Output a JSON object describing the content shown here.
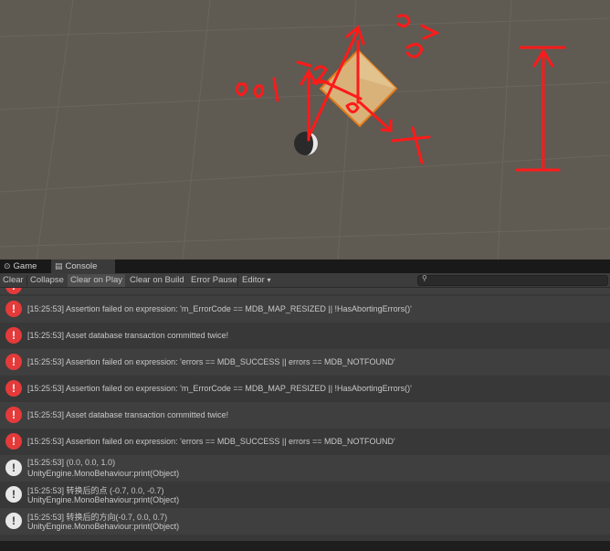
{
  "tabs": {
    "game_label": "Game",
    "console_label": "Console",
    "game_icon": "gamepad-icon",
    "console_icon": "console-icon"
  },
  "toolbar": {
    "clear": "Clear",
    "collapse": "Collapse",
    "clear_on_play": "Clear on Play",
    "clear_on_build": "Clear on Build",
    "error_pause": "Error Pause",
    "editor": "Editor",
    "editor_caret": "▾",
    "search_placeholder": ""
  },
  "logs": [
    {
      "type": "error",
      "line1": "[15:25:53] Assertion failed on expression: 'm_ErrorCode == MDB_MAP_RESIZED || !HasAbortingErrors()'",
      "line2": ""
    },
    {
      "type": "error",
      "line1": "[15:25:53] Asset database transaction committed twice!",
      "line2": ""
    },
    {
      "type": "error",
      "line1": "[15:25:53] Assertion failed on expression: 'errors == MDB_SUCCESS || errors == MDB_NOTFOUND'",
      "line2": ""
    },
    {
      "type": "error",
      "line1": "[15:25:53] Assertion failed on expression: 'm_ErrorCode == MDB_MAP_RESIZED || !HasAbortingErrors()'",
      "line2": ""
    },
    {
      "type": "error",
      "line1": "[15:25:53] Asset database transaction committed twice!",
      "line2": ""
    },
    {
      "type": "error",
      "line1": "[15:25:53] Assertion failed on expression: 'errors == MDB_SUCCESS || errors == MDB_NOTFOUND'",
      "line2": ""
    },
    {
      "type": "info",
      "line1": "[15:25:53] (0.0, 0.0, 1.0)",
      "line2": "UnityEngine.MonoBehaviour:print(Object)"
    },
    {
      "type": "info",
      "line1": "[15:25:53] 转换后的点 (-0.7, 0.0, -0.7)",
      "line2": "UnityEngine.MonoBehaviour:print(Object)"
    },
    {
      "type": "info",
      "line1": "[15:25:53] 转换后的方向(-0.7, 0.0, 0.7)",
      "line2": "UnityEngine.MonoBehaviour:print(Object)"
    }
  ],
  "icons": {
    "error": "!",
    "info": "!"
  },
  "scene": {
    "annotation_color": "#ff1a1a",
    "cube_color": "#d9b27a",
    "handwritten": {
      "o_label": "o",
      "x_label": "x",
      "z_label": "z",
      "v_label": "0.7",
      "w_label": "0.01",
      "n_label": "0.2"
    }
  }
}
